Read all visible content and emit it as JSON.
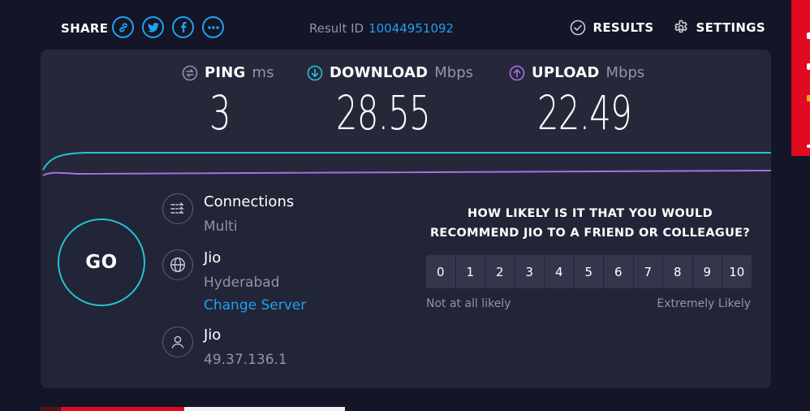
{
  "topbar": {
    "share_label": "SHARE",
    "share_buttons": [
      {
        "icon": "link-icon"
      },
      {
        "icon": "twitter-icon"
      },
      {
        "icon": "facebook-icon"
      },
      {
        "icon": "more-dots-icon"
      }
    ],
    "result_label": "Result ID",
    "result_id": "10044951092",
    "results_label": "RESULTS",
    "settings_label": "SETTINGS"
  },
  "metrics": {
    "ping": {
      "label": "PING",
      "unit": "ms",
      "value": "3",
      "icon": "ping-icon"
    },
    "download": {
      "label": "DOWNLOAD",
      "unit": "Mbps",
      "value": "28.55",
      "icon": "download-arrow-icon"
    },
    "upload": {
      "label": "UPLOAD",
      "unit": "Mbps",
      "value": "22.49",
      "icon": "upload-arrow-icon"
    }
  },
  "go_label": "GO",
  "connections": {
    "title": "Connections",
    "value": "Multi",
    "icon": "connections-icon"
  },
  "server": {
    "name": "Jio",
    "location": "Hyderabad",
    "change_label": "Change Server",
    "icon": "globe-icon"
  },
  "isp": {
    "name": "Jio",
    "ip": "49.37.136.1",
    "icon": "user-icon"
  },
  "survey": {
    "question_line1": "HOW LIKELY IS IT THAT YOU WOULD",
    "question_line2": "RECOMMEND JIO TO A FRIEND OR COLLEAGUE?",
    "scale": [
      "0",
      "1",
      "2",
      "3",
      "4",
      "5",
      "6",
      "7",
      "8",
      "9",
      "10"
    ],
    "low_label": "Not at all likely",
    "high_label": "Extremely Likely"
  },
  "colors": {
    "background": "#141526",
    "panel": "#26283a",
    "accent_blue": "#1fa1f2",
    "download_cyan": "#22c4d6",
    "upload_purple": "#a86fe0",
    "ad_red": "#e10b1f"
  }
}
